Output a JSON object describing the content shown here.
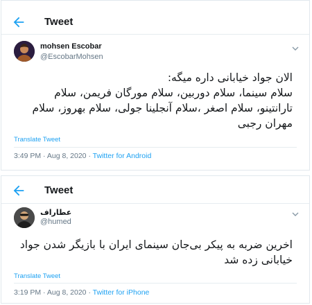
{
  "colors": {
    "accent": "#1da1f2",
    "text": "#14171a",
    "muted": "#657786",
    "border": "#e1e8ed"
  },
  "tweets": [
    {
      "header_title": "Tweet",
      "back_icon": "arrow-left-icon",
      "author": {
        "name": "mohsen Escobar",
        "handle": "@EscobarMohsen"
      },
      "text_lines": [
        "الان جواد خیابانی داره میگه:",
        "سلام سینما، سلام دوربین، سلام مورگان فریمن، سلام",
        "تارانتینو، سلام اصغر ،سلام آنجلینا جولی، سلام بهروز، سلام",
        "مهران رجبی"
      ],
      "translate_label": "Translate Tweet",
      "time": "3:49 PM",
      "date": "Aug 8, 2020",
      "separator": "·",
      "source": "Twitter for Android"
    },
    {
      "header_title": "Tweet",
      "back_icon": "arrow-left-icon",
      "author": {
        "name": "عطاراف",
        "handle": "@humed"
      },
      "text_lines": [
        "اخرین ضربه به پیکر بی‌جان سینمای ایران با بازیگر شدن جواد",
        "خیابانی زده شد"
      ],
      "translate_label": "Translate Tweet",
      "time": "3:19 PM",
      "date": "Aug 8, 2020",
      "separator": "·",
      "source": "Twitter for iPhone"
    }
  ]
}
